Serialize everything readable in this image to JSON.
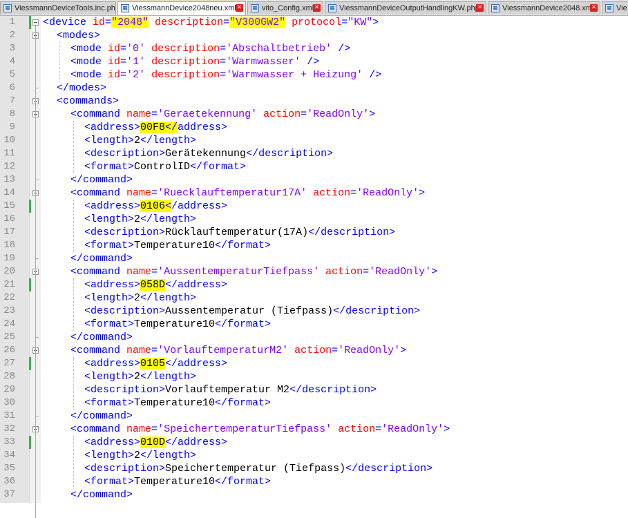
{
  "tabs": [
    {
      "label": "ViessmannDeviceTools.inc.php",
      "active": false,
      "closable": false
    },
    {
      "label": "ViessmannDevice2048neu.xml",
      "active": true,
      "closable": true
    },
    {
      "label": "vito_Config.xml",
      "active": false,
      "closable": true
    },
    {
      "label": "ViessmannDeviceOutputHandlingKW.php",
      "active": false,
      "closable": true
    },
    {
      "label": "ViessmannDevice2048.xml",
      "active": false,
      "closable": true
    },
    {
      "label": "Vie",
      "active": false,
      "closable": false
    }
  ],
  "changed_lines": [
    1,
    15,
    21,
    27,
    33
  ],
  "editor_lines": [
    {
      "n": "1",
      "indent": 0,
      "tokens": [
        [
          "tg",
          "<device"
        ],
        [
          "tx",
          " "
        ],
        [
          "at",
          "id"
        ],
        [
          "tg",
          "="
        ],
        [
          "av",
          "\"2048\"",
          "hl"
        ],
        [
          "tx",
          " "
        ],
        [
          "at",
          "description"
        ],
        [
          "tg",
          "="
        ],
        [
          "av",
          "\"V300GW2\"",
          "hl"
        ],
        [
          "tx",
          " "
        ],
        [
          "at",
          "protocol"
        ],
        [
          "tg",
          "="
        ],
        [
          "av",
          "\"KW\""
        ],
        [
          "tg",
          ">"
        ]
      ]
    },
    {
      "n": "2",
      "indent": 1,
      "tokens": [
        [
          "tg",
          "<modes>"
        ]
      ]
    },
    {
      "n": "3",
      "indent": 2,
      "tokens": [
        [
          "tg",
          "<mode"
        ],
        [
          "tx",
          " "
        ],
        [
          "at",
          "id"
        ],
        [
          "tg",
          "="
        ],
        [
          "av",
          "'0'"
        ],
        [
          "tx",
          " "
        ],
        [
          "at",
          "description"
        ],
        [
          "tg",
          "="
        ],
        [
          "av",
          "'Abschaltbetrieb'"
        ],
        [
          "tx",
          " "
        ],
        [
          "tg",
          "/>"
        ]
      ]
    },
    {
      "n": "4",
      "indent": 2,
      "tokens": [
        [
          "tg",
          "<mode"
        ],
        [
          "tx",
          " "
        ],
        [
          "at",
          "id"
        ],
        [
          "tg",
          "="
        ],
        [
          "av",
          "'1'"
        ],
        [
          "tx",
          " "
        ],
        [
          "at",
          "description"
        ],
        [
          "tg",
          "="
        ],
        [
          "av",
          "'Warmwasser'"
        ],
        [
          "tx",
          " "
        ],
        [
          "tg",
          "/>"
        ]
      ]
    },
    {
      "n": "5",
      "indent": 2,
      "tokens": [
        [
          "tg",
          "<mode"
        ],
        [
          "tx",
          " "
        ],
        [
          "at",
          "id"
        ],
        [
          "tg",
          "="
        ],
        [
          "av",
          "'2'"
        ],
        [
          "tx",
          " "
        ],
        [
          "at",
          "description"
        ],
        [
          "tg",
          "="
        ],
        [
          "av",
          "'Warmwasser + Heizung'"
        ],
        [
          "tx",
          " "
        ],
        [
          "tg",
          "/>"
        ]
      ]
    },
    {
      "n": "6",
      "indent": 1,
      "tokens": [
        [
          "tg",
          "</modes>"
        ]
      ]
    },
    {
      "n": "7",
      "indent": 1,
      "tokens": [
        [
          "tg",
          "<commands>"
        ]
      ]
    },
    {
      "n": "8",
      "indent": 2,
      "tokens": [
        [
          "tg",
          "<command"
        ],
        [
          "tx",
          " "
        ],
        [
          "at",
          "name"
        ],
        [
          "tg",
          "="
        ],
        [
          "av",
          "'Geraetekennung'"
        ],
        [
          "tx",
          " "
        ],
        [
          "at",
          "action"
        ],
        [
          "tg",
          "="
        ],
        [
          "av",
          "'ReadOnly'"
        ],
        [
          "tg",
          ">"
        ]
      ]
    },
    {
      "n": "9",
      "indent": 3,
      "tokens": [
        [
          "tg",
          "<address>"
        ],
        [
          "tx",
          "00F8",
          "hl"
        ],
        [
          "tg",
          "</",
          "hl"
        ],
        [
          "tg",
          "address>"
        ]
      ]
    },
    {
      "n": "10",
      "indent": 3,
      "tokens": [
        [
          "tg",
          "<length>"
        ],
        [
          "tx",
          "2"
        ],
        [
          "tg",
          "</length>"
        ]
      ]
    },
    {
      "n": "11",
      "indent": 3,
      "tokens": [
        [
          "tg",
          "<description>"
        ],
        [
          "tx",
          "Gerätekennung"
        ],
        [
          "tg",
          "</description>"
        ]
      ]
    },
    {
      "n": "12",
      "indent": 3,
      "tokens": [
        [
          "tg",
          "<format>"
        ],
        [
          "tx",
          "ControlID"
        ],
        [
          "tg",
          "</format>"
        ]
      ]
    },
    {
      "n": "13",
      "indent": 2,
      "tokens": [
        [
          "tg",
          "</command>"
        ]
      ]
    },
    {
      "n": "14",
      "indent": 2,
      "tokens": [
        [
          "tg",
          "<command"
        ],
        [
          "tx",
          " "
        ],
        [
          "at",
          "name"
        ],
        [
          "tg",
          "="
        ],
        [
          "av",
          "'Ruecklauftemperatur17A'"
        ],
        [
          "tx",
          " "
        ],
        [
          "at",
          "action"
        ],
        [
          "tg",
          "="
        ],
        [
          "av",
          "'ReadOnly'"
        ],
        [
          "tg",
          ">"
        ]
      ]
    },
    {
      "n": "15",
      "indent": 3,
      "tokens": [
        [
          "tg",
          "<address>"
        ],
        [
          "tx",
          "0106",
          "hl"
        ],
        [
          "tg",
          "<",
          "hl"
        ],
        [
          "tg",
          "/address>"
        ]
      ]
    },
    {
      "n": "16",
      "indent": 3,
      "tokens": [
        [
          "tg",
          "<length>"
        ],
        [
          "tx",
          "2"
        ],
        [
          "tg",
          "</length>"
        ]
      ]
    },
    {
      "n": "17",
      "indent": 3,
      "tokens": [
        [
          "tg",
          "<description>"
        ],
        [
          "tx",
          "Rücklauftemperatur(17A)"
        ],
        [
          "tg",
          "</description>"
        ]
      ]
    },
    {
      "n": "18",
      "indent": 3,
      "tokens": [
        [
          "tg",
          "<format>"
        ],
        [
          "tx",
          "Temperature10"
        ],
        [
          "tg",
          "</format>"
        ]
      ]
    },
    {
      "n": "19",
      "indent": 2,
      "tokens": [
        [
          "tg",
          "</command>"
        ]
      ]
    },
    {
      "n": "20",
      "indent": 2,
      "tokens": [
        [
          "tg",
          "<command"
        ],
        [
          "tx",
          " "
        ],
        [
          "at",
          "name"
        ],
        [
          "tg",
          "="
        ],
        [
          "av",
          "'AussentemperaturTiefpass'"
        ],
        [
          "tx",
          " "
        ],
        [
          "at",
          "action"
        ],
        [
          "tg",
          "="
        ],
        [
          "av",
          "'ReadOnly'"
        ],
        [
          "tg",
          ">"
        ]
      ]
    },
    {
      "n": "21",
      "indent": 3,
      "tokens": [
        [
          "tg",
          "<address>"
        ],
        [
          "tx",
          "058D",
          "hl"
        ],
        [
          "tg",
          "</address>"
        ]
      ]
    },
    {
      "n": "22",
      "indent": 3,
      "tokens": [
        [
          "tg",
          "<length>"
        ],
        [
          "tx",
          "2"
        ],
        [
          "tg",
          "</length>"
        ]
      ]
    },
    {
      "n": "23",
      "indent": 3,
      "tokens": [
        [
          "tg",
          "<description>"
        ],
        [
          "tx",
          "Aussentemperatur (Tiefpass)"
        ],
        [
          "tg",
          "</description>"
        ]
      ]
    },
    {
      "n": "24",
      "indent": 3,
      "tokens": [
        [
          "tg",
          "<format>"
        ],
        [
          "tx",
          "Temperature10"
        ],
        [
          "tg",
          "</format>"
        ]
      ]
    },
    {
      "n": "25",
      "indent": 2,
      "tokens": [
        [
          "tg",
          "</command>"
        ]
      ]
    },
    {
      "n": "26",
      "indent": 2,
      "tokens": [
        [
          "tg",
          "<command"
        ],
        [
          "tx",
          " "
        ],
        [
          "at",
          "name"
        ],
        [
          "tg",
          "="
        ],
        [
          "av",
          "'VorlauftemperaturM2'"
        ],
        [
          "tx",
          " "
        ],
        [
          "at",
          "action"
        ],
        [
          "tg",
          "="
        ],
        [
          "av",
          "'ReadOnly'"
        ],
        [
          "tg",
          ">"
        ]
      ]
    },
    {
      "n": "27",
      "indent": 3,
      "tokens": [
        [
          "tg",
          "<address>"
        ],
        [
          "tx",
          "0105",
          "hl"
        ],
        [
          "tg",
          "</address>"
        ]
      ]
    },
    {
      "n": "28",
      "indent": 3,
      "tokens": [
        [
          "tg",
          "<length>"
        ],
        [
          "tx",
          "2"
        ],
        [
          "tg",
          "</length>"
        ]
      ]
    },
    {
      "n": "29",
      "indent": 3,
      "tokens": [
        [
          "tg",
          "<description>"
        ],
        [
          "tx",
          "Vorlauftemperatur M2"
        ],
        [
          "tg",
          "</description>"
        ]
      ]
    },
    {
      "n": "30",
      "indent": 3,
      "tokens": [
        [
          "tg",
          "<format>"
        ],
        [
          "tx",
          "Temperature10"
        ],
        [
          "tg",
          "</format>"
        ]
      ]
    },
    {
      "n": "31",
      "indent": 2,
      "tokens": [
        [
          "tg",
          "</command>"
        ]
      ]
    },
    {
      "n": "32",
      "indent": 2,
      "tokens": [
        [
          "tg",
          "<command"
        ],
        [
          "tx",
          " "
        ],
        [
          "at",
          "name"
        ],
        [
          "tg",
          "="
        ],
        [
          "av",
          "'SpeichertemperaturTiefpass'"
        ],
        [
          "tx",
          " "
        ],
        [
          "at",
          "action"
        ],
        [
          "tg",
          "="
        ],
        [
          "av",
          "'ReadOnly'"
        ],
        [
          "tg",
          ">"
        ]
      ]
    },
    {
      "n": "33",
      "indent": 3,
      "tokens": [
        [
          "tg",
          "<address>"
        ],
        [
          "tx",
          "010D",
          "hl"
        ],
        [
          "tg",
          "</address>"
        ]
      ]
    },
    {
      "n": "34",
      "indent": 3,
      "tokens": [
        [
          "tg",
          "<length>"
        ],
        [
          "tx",
          "2"
        ],
        [
          "tg",
          "</length>"
        ]
      ]
    },
    {
      "n": "35",
      "indent": 3,
      "tokens": [
        [
          "tg",
          "<description>"
        ],
        [
          "tx",
          "Speichertemperatur (Tiefpass)"
        ],
        [
          "tg",
          "</description>"
        ]
      ]
    },
    {
      "n": "36",
      "indent": 3,
      "tokens": [
        [
          "tg",
          "<format>"
        ],
        [
          "tx",
          "Temperature10"
        ],
        [
          "tg",
          "</format>"
        ]
      ]
    },
    {
      "n": "37",
      "indent": 2,
      "tokens": [
        [
          "tg",
          "</command>"
        ]
      ]
    }
  ]
}
